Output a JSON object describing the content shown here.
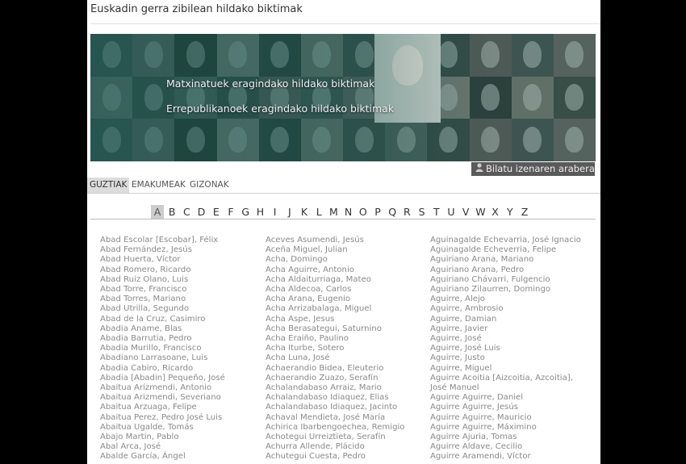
{
  "site_title": "Euskadin gerra zibilean hildako biktimak",
  "banner": {
    "link_1": "Matxinatuek eragindako hildako biktimak",
    "link_2": "Errepublikanoek eragindako hildako biktimak",
    "search_label": "Bilatu izenaren arabera"
  },
  "tabs": [
    "GUZTIAK",
    "EMAKUMEAK",
    "GIZONAK"
  ],
  "active_tab": "GUZTIAK",
  "letters": [
    "A",
    "B",
    "C",
    "D",
    "E",
    "F",
    "G",
    "H",
    "I",
    "J",
    "K",
    "L",
    "M",
    "N",
    "O",
    "P",
    "Q",
    "R",
    "S",
    "T",
    "U",
    "V",
    "W",
    "X",
    "Y",
    "Z"
  ],
  "active_letter": "A",
  "columns": [
    [
      "Abad Escolar [Escobar], Félix",
      "Abad Fernández, Jesús",
      "Abad Huerta, Víctor",
      "Abad Romero, Ricardo",
      "Abad Ruiz Olano, Luis",
      "Abad Torre, Francisco",
      "Abad Torres, Mariano",
      "Abad Utrilla, Segundo",
      "Abad de la Cruz, Casimiro",
      "Abadia Aname, Blas",
      "Abadia Barrutia, Pedro",
      "Abadia Murillo, Francisco",
      "Abadiano Larrasoane, Luis",
      "Abadia Cabiro, Ricardo",
      "Abadia [Abadin] Pequeño, José",
      "Abaitua Arizmendi, Antonio",
      "Abaitua Arizmendi, Severiano",
      "Abaitua Arzuaga, Felipe",
      "Abaitua Perez, Pedro José Luis",
      "Abaitua Ugalde, Tomás",
      "Abajo Martin, Pablo",
      "Abal Arca, José",
      "Abalde García, Ángel"
    ],
    [
      "Aceves Asumendi, Jesús",
      "Aceña Miguel, Julian",
      "Acha, Domingo",
      "Acha Aguirre, Antonio",
      "Acha Aldaiturriaga, Mateo",
      "Acha Aldecoa, Carlos",
      "Acha Arana, Eugenio",
      "Acha Arrizabalaga, Miguel",
      "Acha Aspe, Jesus",
      "Acha Berasategui, Saturnino",
      "Acha Eraiño, Paulino",
      "Acha Iturbe, Sotero",
      "Acha Luna, José",
      "Achaerandio Bidea, Eleuterio",
      "Achaerandio Zuazo, Serafín",
      "Achalandabaso Arraiz, Mario",
      "Achalandabaso Idiaquez, Elias",
      "Achalandabaso Idiaquez, Jacinto",
      "Achaval Mendieta, José María",
      "Achirica Ibarbengoechea, Remigio",
      "Achotegui Urreiztieta, Serafín",
      "Achurra Allende, Plácido",
      "Achutegui Cuesta, Pedro"
    ],
    [
      "Aguinagalde Echevarria, José Ignacio",
      "Aguinagalde Echeverria, Felipe",
      "Aguiriano Arana, Mariano",
      "Aguiriano Arana, Pedro",
      "Aguiriano Chávarri, Fulgencio",
      "Aguiriano Zilaurren, Domingo",
      "Aguirre, Alejo",
      "Aguirre, Ambrosio",
      "Aguirre, Damian",
      "Aguirre, Javier",
      "Aguirre, José",
      "Aguirre, José Luis",
      "Aguirre, Justo",
      "Aguirre, Miguel",
      "Aguirre Acoitia [Aizcoitia, Azcoitia], José Manuel",
      "Aguirre Aguirre, Daniel",
      "Aguirre Aguirre, Jesús",
      "Aguirre Aguirre, Mauricio",
      "Aguirre Aguirre, Máximino",
      "Aguirre Ajuria, Tomas",
      "Aguirre Aldave, Cecilio",
      "Aguirre Aramendi, Víctor"
    ]
  ],
  "colors": {
    "background": "#000000",
    "page": "#ffffff",
    "name_link": "#8a8a8a",
    "banner_tint": "#2f4a46",
    "active_tab": "#dcdcdc",
    "search_button": "#5a5a5a"
  }
}
